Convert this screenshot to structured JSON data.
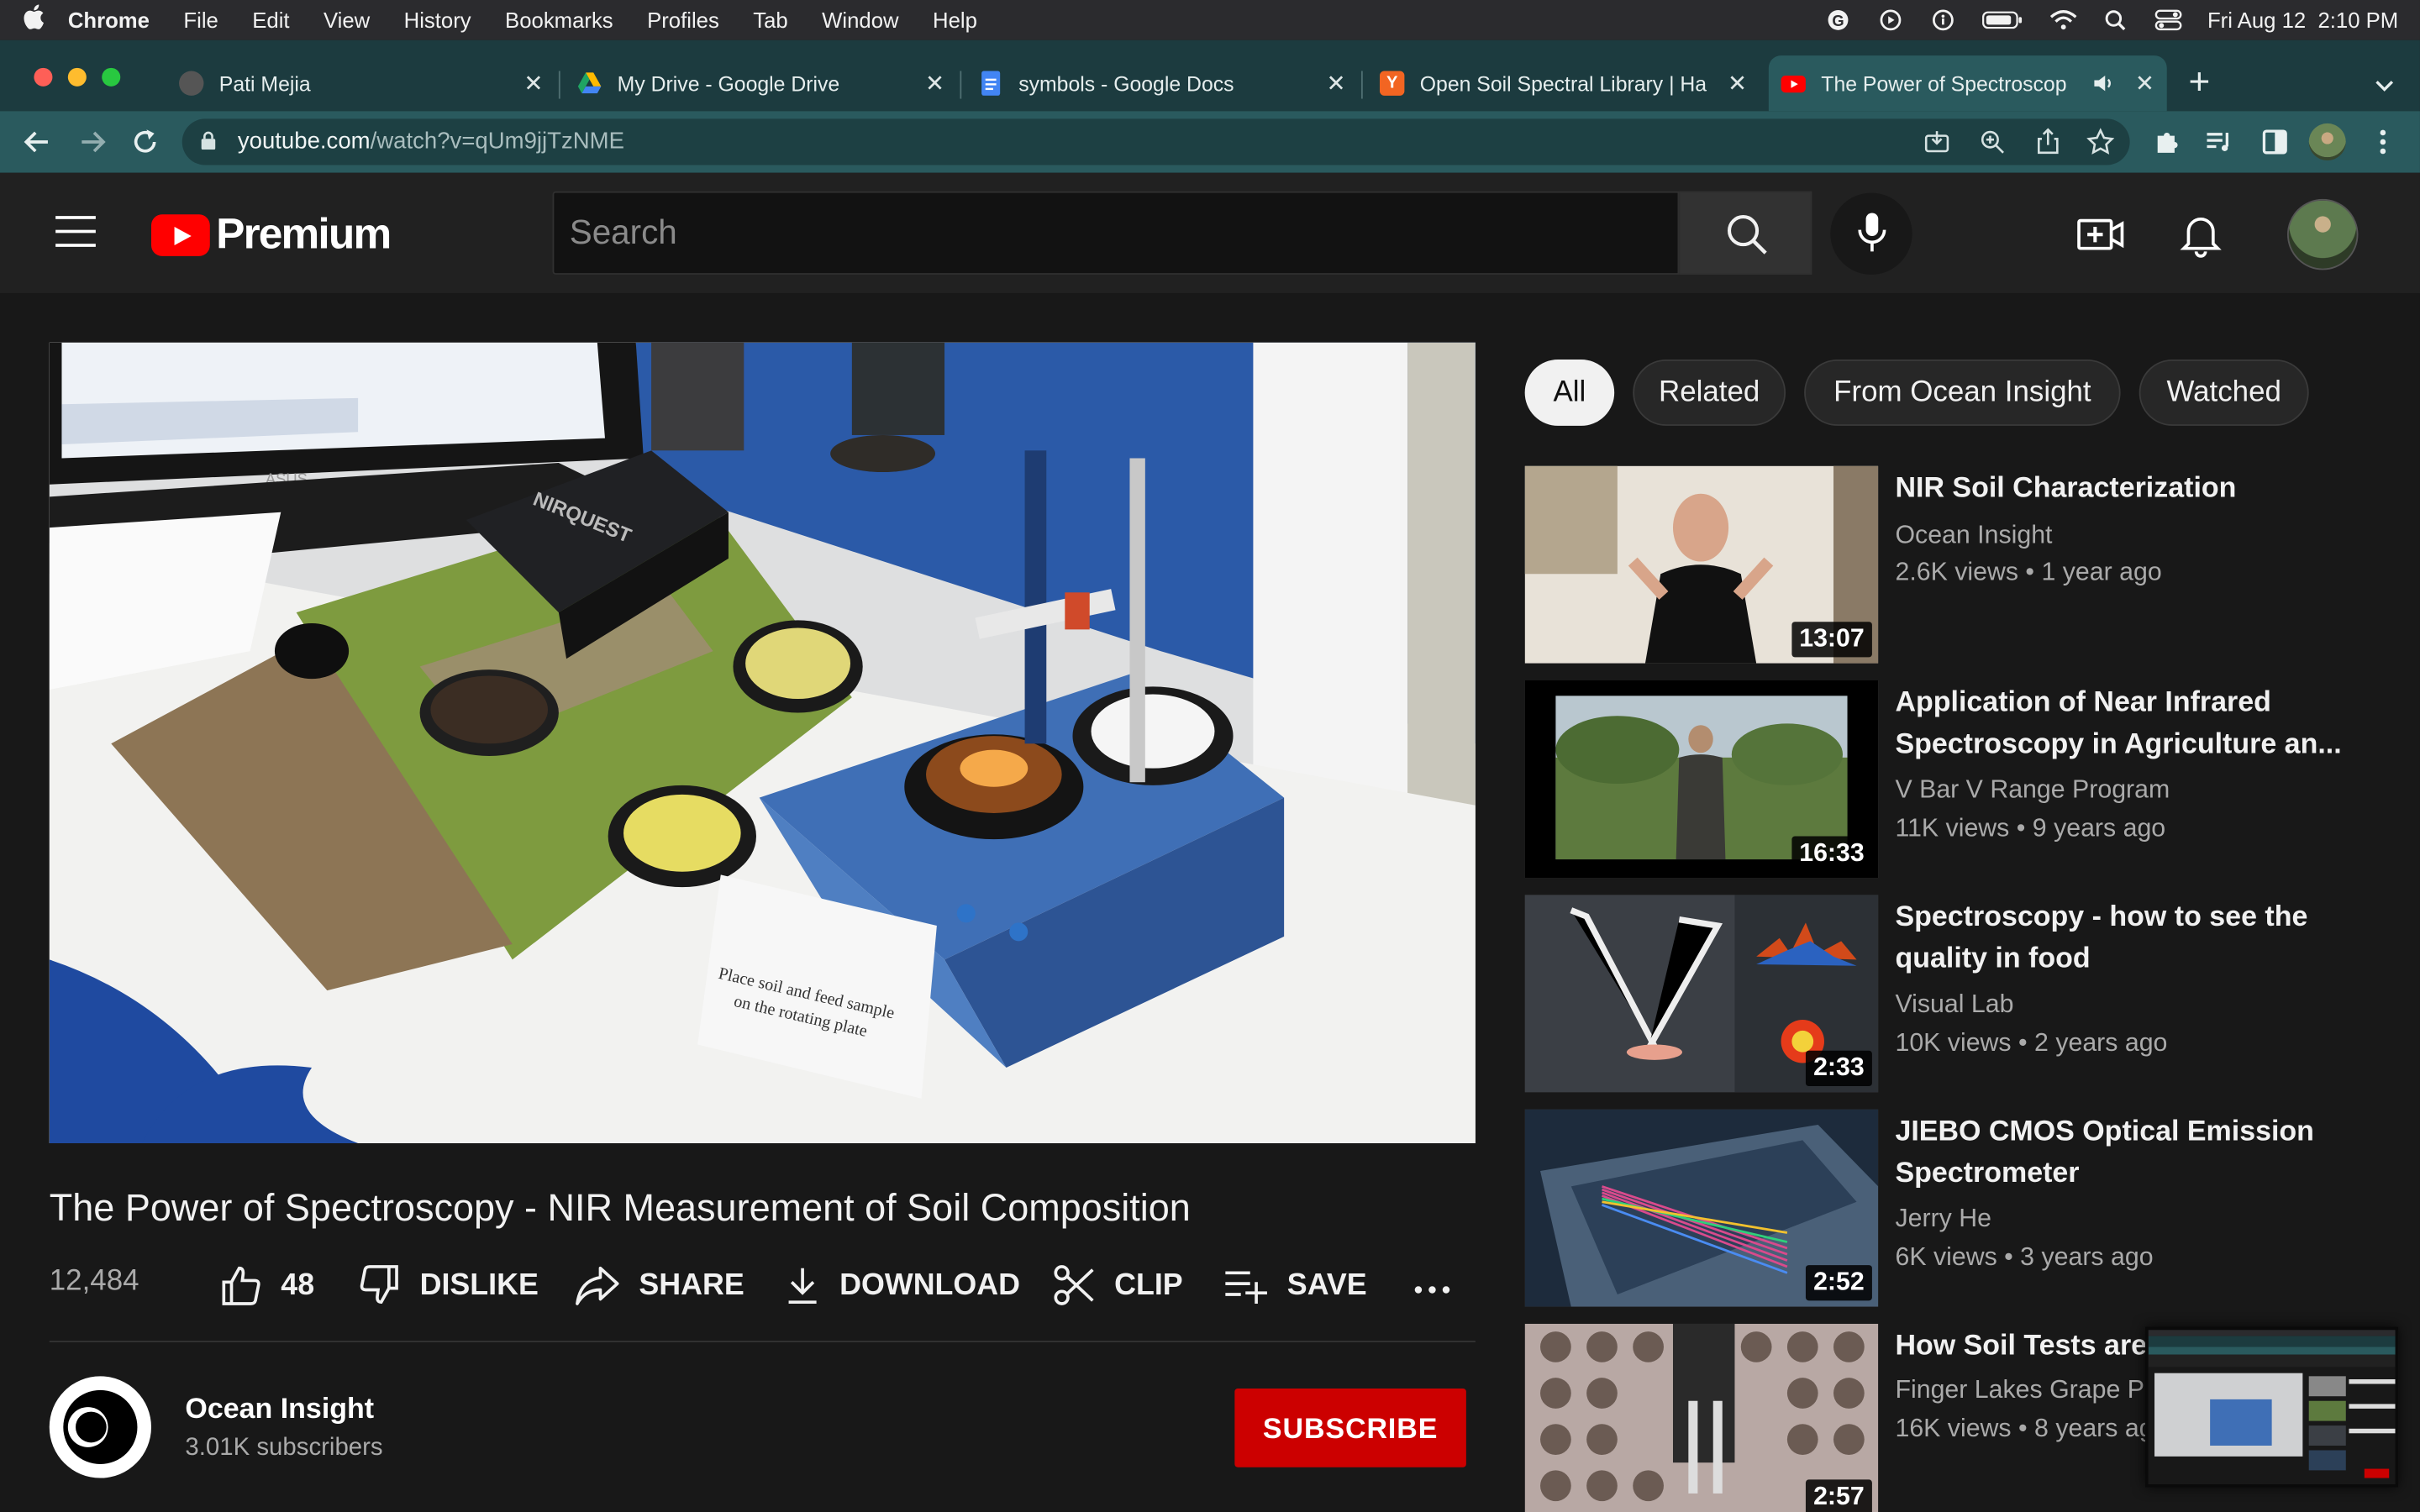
{
  "menubar": {
    "app": "Chrome",
    "items": [
      "File",
      "Edit",
      "View",
      "History",
      "Bookmarks",
      "Profiles",
      "Tab",
      "Window",
      "Help"
    ],
    "datetime": "Fri Aug 12  2:10 PM"
  },
  "tabs": [
    {
      "title": "Pati Mejia",
      "favicon_color": "#444444"
    },
    {
      "title": "My Drive - Google Drive",
      "favicon_color": "#1fa463"
    },
    {
      "title": "symbols - Google Docs",
      "favicon_color": "#4285f4"
    },
    {
      "title": "Open Soil Spectral Library | Ha",
      "favicon_color": "#f26522"
    },
    {
      "title": "The Power of Spectroscop",
      "favicon_color": "#ff0000",
      "active": true
    }
  ],
  "address": {
    "domain": "youtube.com",
    "path": "/watch?v=qUm9jjTzNME"
  },
  "youtube": {
    "logo_text": "Premium",
    "search_placeholder": "Search"
  },
  "video": {
    "title": "The Power of Spectroscopy - NIR Measurement of Soil Composition",
    "views": "12,484",
    "likes": "48",
    "actions": {
      "dislike": "DISLIKE",
      "share": "SHARE",
      "download": "DOWNLOAD",
      "clip": "CLIP",
      "save": "SAVE"
    },
    "scene_text": {
      "device_brand": "NIRQUEST",
      "monitor_brand": "ASUS",
      "card_line1": "Place soil and feed sample",
      "card_line2": "on the rotating plate"
    }
  },
  "channel": {
    "name": "Ocean Insight",
    "subscribers": "3.01K subscribers",
    "subscribe_label": "SUBSCRIBE"
  },
  "chips": [
    "All",
    "Related",
    "From Ocean Insight",
    "Watched"
  ],
  "related": [
    {
      "title": "NIR Soil Characterization",
      "channel": "Ocean Insight",
      "meta": "2.6K views • 1 year ago",
      "duration": "13:07"
    },
    {
      "title": "Application of Near Infrared Spectroscopy in Agriculture an...",
      "channel": "V Bar V Range Program",
      "meta": "11K views • 9 years ago",
      "duration": "16:33"
    },
    {
      "title": "Spectroscopy - how to see the quality in food",
      "channel": "Visual Lab",
      "meta": "10K views • 2 years ago",
      "duration": "2:33"
    },
    {
      "title": "JIEBO CMOS Optical Emission Spectrometer",
      "channel": "Jerry He",
      "meta": "6K views • 3 years ago",
      "duration": "2:52"
    },
    {
      "title": "How Soil Tests are",
      "channel": "Finger Lakes Grape Pr",
      "meta": "16K views • 8 years ag",
      "duration": "2:57"
    }
  ]
}
